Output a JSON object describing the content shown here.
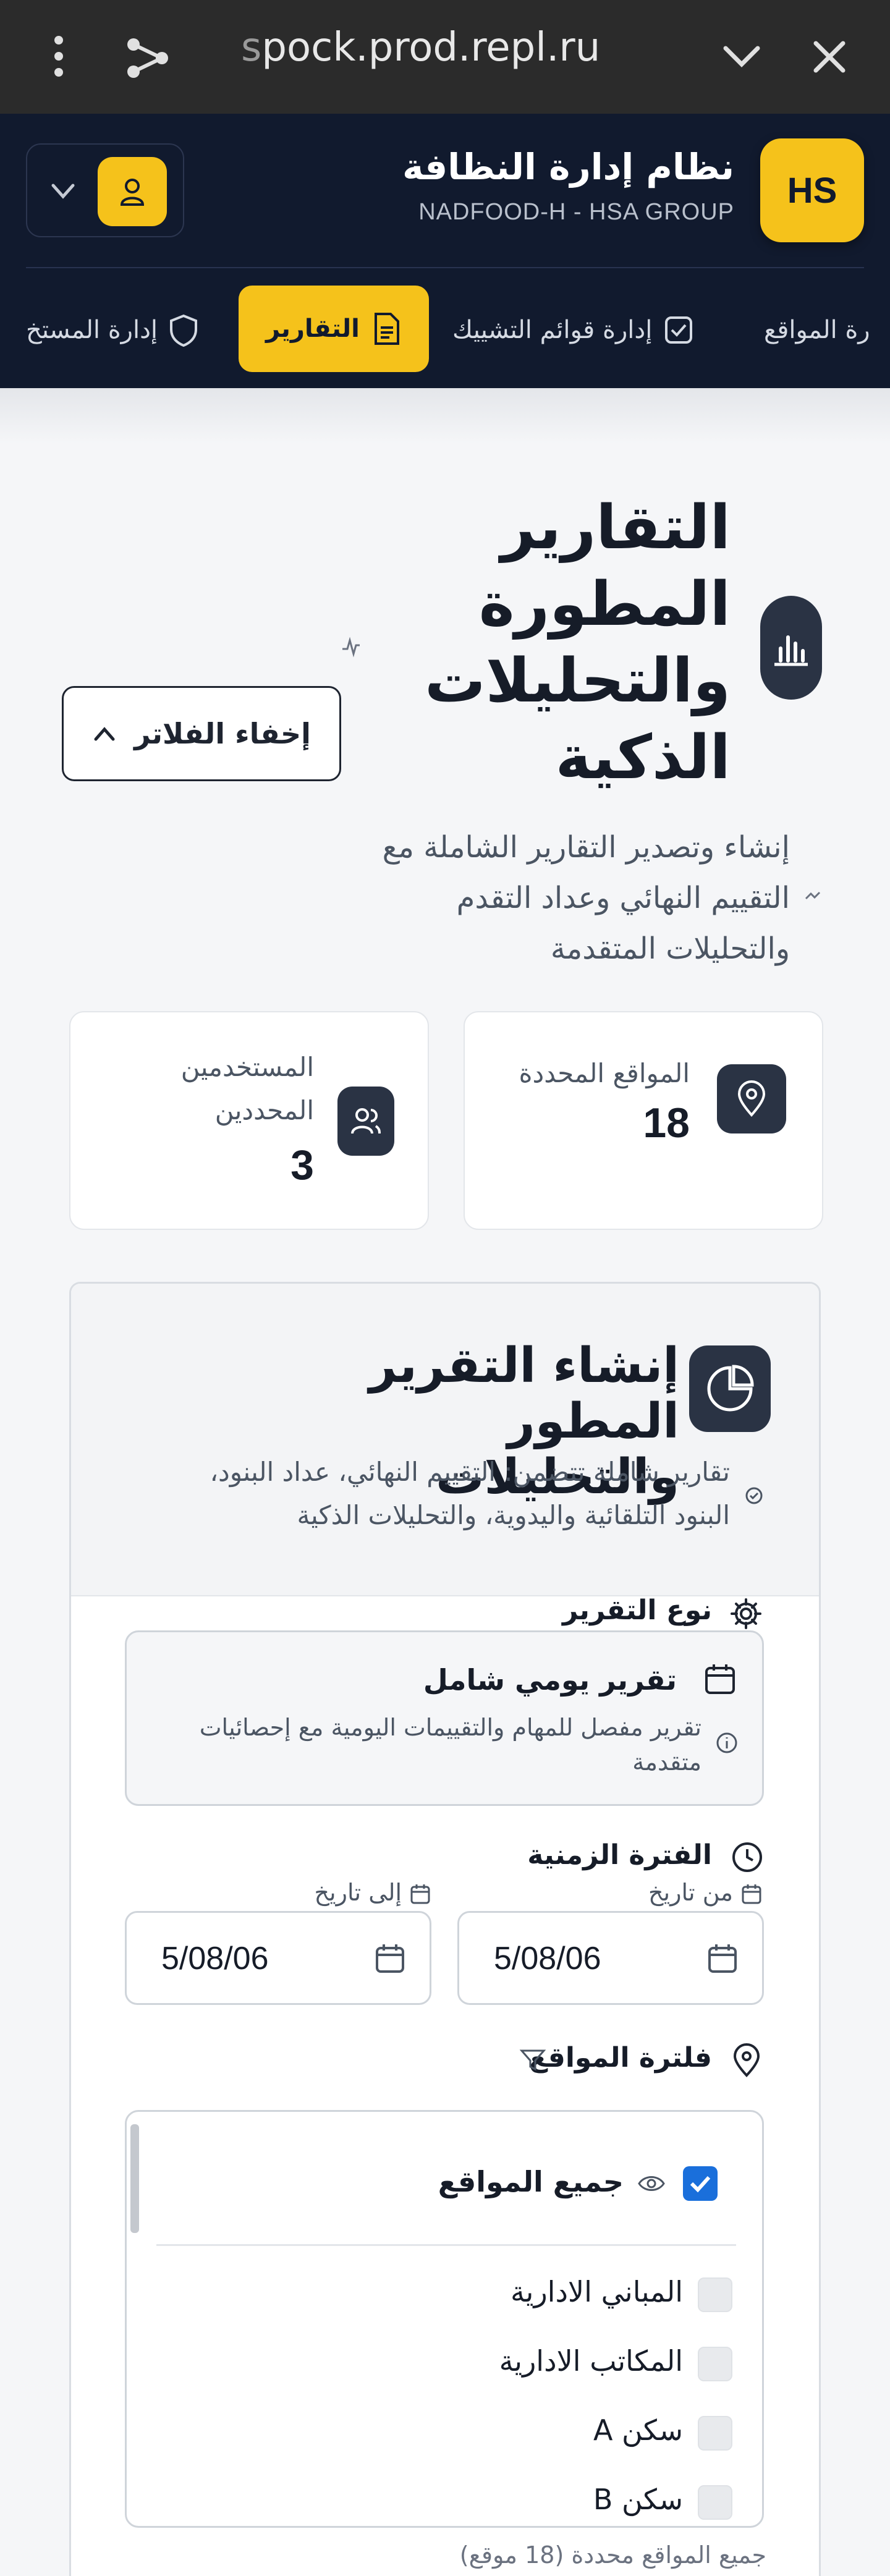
{
  "browser": {
    "url_fade": "s",
    "url": "pock.prod.repl.ru"
  },
  "header": {
    "logo": "HS",
    "title": "نظام إدارة النظافة",
    "subtitle": "NADFOOD-H - HSA GROUP"
  },
  "nav": {
    "items": [
      {
        "label": "رة المواقع"
      },
      {
        "label": "إدارة قوائم التشييك"
      },
      {
        "label": "التقارير"
      },
      {
        "label": "إدارة المستخ"
      }
    ]
  },
  "page": {
    "title_lines": [
      "التقارير",
      "المطورة",
      "والتحليلات",
      "الذكية"
    ],
    "hide_filters": "إخفاء الفلاتر",
    "desc_lines": [
      "إنشاء وتصدير التقارير الشاملة مع",
      "التقييم النهائي وعداد التقدم",
      "والتحليلات المتقدمة"
    ]
  },
  "stats": {
    "sites": {
      "label": "المواقع المحددة",
      "value": "18"
    },
    "users": {
      "label_lines": [
        "المستخدمين",
        "المحددين"
      ],
      "value": "3"
    }
  },
  "panel": {
    "title_lines": [
      "إنشاء التقرير المطور",
      "والتحليلات"
    ],
    "desc_lines": [
      "تقارير شاملة تتضمن: التقييم النهائي، عداد البنود،",
      "البنود التلقائية واليدوية، والتحليلات الذكية"
    ],
    "report_type_label": "نوع التقرير",
    "report_type": {
      "name": "تقرير يومي شامل",
      "desc_lines": [
        "تقرير مفصل للمهام والتقييمات اليومية مع إحصائيات",
        "متقدمة"
      ]
    },
    "period_label": "الفترة الزمنية",
    "from_label": "من تاريخ",
    "to_label": "إلى تاريخ",
    "from_value": "5/08/06",
    "to_value": "5/08/06",
    "sites_filter_label": "فلترة المواقع",
    "all_sites": "جميع المواقع",
    "sites": [
      "المباني الادارية",
      "المكاتب الادارية",
      "سكن A",
      "سكن B"
    ],
    "footer_note": "جميع المواقع محددة (18 موقع)"
  }
}
